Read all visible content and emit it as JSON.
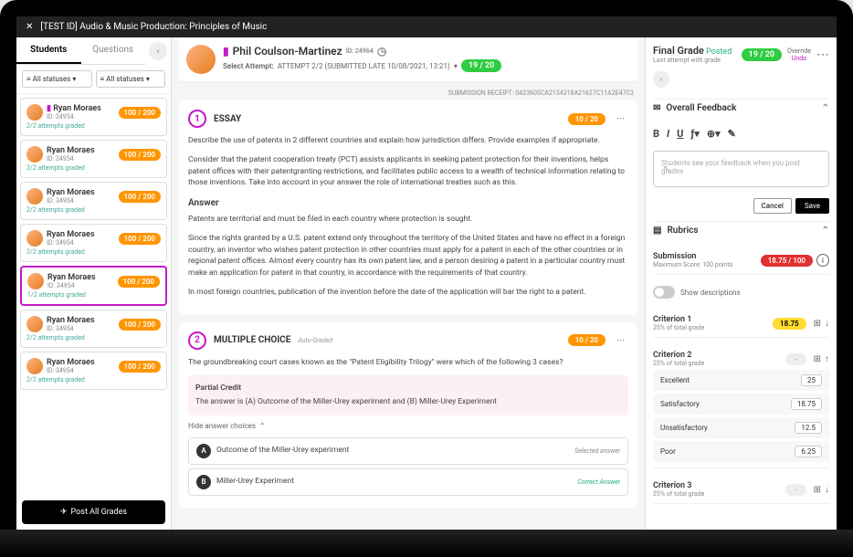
{
  "titlebar": {
    "course": "[TEST ID]  Audio & Music Production: Principles of Music"
  },
  "sidebar": {
    "tabs": [
      "Students",
      "Questions"
    ],
    "filter1": "All statuses",
    "filter2": "All statuses",
    "students": [
      {
        "name": "Ryan Moraes",
        "id": "ID: 34954",
        "grade": "100 / 200",
        "attempts": "2/2 attempts graded",
        "flagged": true
      },
      {
        "name": "Ryan Moraes",
        "id": "ID: 34954",
        "grade": "100 / 200",
        "attempts": "2/2 attempts graded"
      },
      {
        "name": "Ryan Moraes",
        "id": "ID: 34954",
        "grade": "100 / 200",
        "attempts": "2/2 attempts graded"
      },
      {
        "name": "Ryan Moraes",
        "id": "ID: 34954",
        "grade": "100 / 200",
        "attempts": "2/2 attempts graded"
      },
      {
        "name": "Ryan Moraes",
        "id": "ID: 34954",
        "grade": "100 / 200",
        "attempts": "1/2 attempts graded",
        "selected": true
      },
      {
        "name": "Ryan Moraes",
        "id": "ID: 34954",
        "grade": "100 / 200",
        "attempts": "2/2 attempts graded"
      },
      {
        "name": "Ryan Moraes",
        "id": "ID: 34954",
        "grade": "100 / 200",
        "attempts": "2/2 attempts graded"
      }
    ],
    "post_btn": "Post All Grades"
  },
  "header": {
    "name": "Phil Coulson-Martinez",
    "id": "ID: 24964",
    "attempt_label": "Select Attempt:",
    "attempt": "ATTEMPT 2/2 (SUBMITTED LATE 10/08/2021, 13:21)",
    "score": "19 / 20"
  },
  "receipt": "SUBMISSION RECEIPT: 0423605CA2154318A21627C11A2E47C3",
  "q1": {
    "num": "1",
    "type": "ESSAY",
    "score": "10 / 20",
    "p1": "Describe the use of patents in 2 different countries and explain how jurisdiction differs. Provide examples if appropriate.",
    "p2": "Consider that the patent cooperation treaty (PCT) assists applicants in seeking patent protection for their inventions, helps patent offices with their patentgranting restrictions, and facilitates public access to a wealth of technical information relating to those inventions. Take into account in your answer the role of international treaties such as this.",
    "ah": "Answer",
    "a1": "Patents are territorial and must be filed in each country where protection is sought.",
    "a2": "Since the rights granted by a U.S. patent extend only throughout the territory of the United States and have no effect in a foreign country, an inventor who wishes patent protection in other countries must apply for a patent in each of the other countries or in regional patent offices. Almost every country has its own patent law, and a person desiring a patent in a particular country must make an application for patent in that country, in accordance with the requirements of that country.",
    "a3": "In most foreign countries, publication of the invention before the date of the application will bar the right to a patent."
  },
  "q2": {
    "num": "2",
    "type": "MULTIPLE CHOICE",
    "auto": "Auto-Graded",
    "score": "10 / 20",
    "prompt": "The groundbreaking court cases known as the \"Patent Eligibility Trilogy\" were which of the following 3 cases?",
    "pc_title": "Partial Credit",
    "pc_body": "The answer is (A) Outcome of the Miller-Urey experiment and (B) Miller-Urey Experiment",
    "hide": "Hide answer choices",
    "choiceA": {
      "l": "A",
      "t": "Outcome of the Miller-Urey experiment",
      "s": "Selected answer"
    },
    "choiceB": {
      "l": "B",
      "t": "Miller-Urey Experiment",
      "s": "Correct Answer"
    }
  },
  "right": {
    "final": "Final Grade",
    "posted": "Posted",
    "sub": "Last attempt with grade",
    "score": "19 / 20",
    "override": "Override",
    "undo": "Undo",
    "ovf": "Overall Feedback",
    "fb_placeholder": "Students see your feedback when you post grades",
    "cancel": "Cancel",
    "save": "Save",
    "rubrics": "Rubrics",
    "submission": "Submission",
    "max": "Maximum Score: 100 points",
    "sub_score": "18.75 / 100",
    "show_desc": "Show descriptions",
    "crit1": {
      "name": "Criterion 1",
      "pct": "25% of total grade",
      "score": "18.75"
    },
    "crit2": {
      "name": "Criterion 2",
      "pct": "25% of total grade",
      "score": "-",
      "levels": [
        {
          "n": "Excellent",
          "s": "25"
        },
        {
          "n": "Satisfactory",
          "s": "18.75"
        },
        {
          "n": "Unsatisfactory",
          "s": "12.5"
        },
        {
          "n": "Poor",
          "s": "6.25"
        }
      ]
    },
    "crit3": {
      "name": "Criterion 3",
      "pct": "25% of total grade",
      "score": "-"
    }
  }
}
